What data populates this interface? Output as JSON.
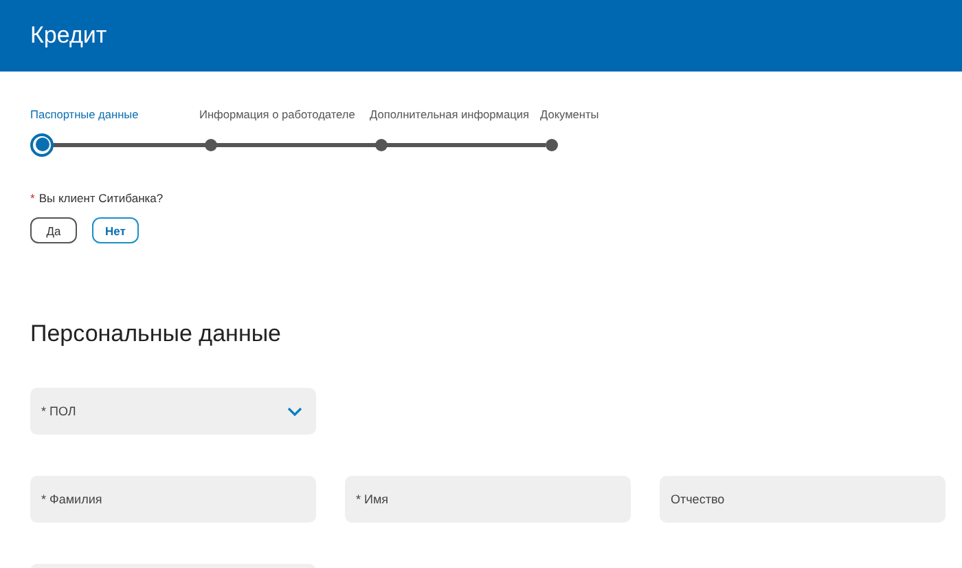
{
  "header": {
    "title": "Кредит"
  },
  "steps": [
    {
      "label": "Паспортные данные",
      "selected": true
    },
    {
      "label": "Информация о работодателе",
      "selected": false
    },
    {
      "label": "Дополнительная информация",
      "selected": false
    },
    {
      "label": "Документы",
      "selected": false
    }
  ],
  "question": {
    "mark": "*",
    "text": "Вы клиент Ситибанка?"
  },
  "answers": [
    {
      "label": "Да",
      "selected": false
    },
    {
      "label": "Нет",
      "selected": true
    }
  ],
  "section_title": "Персональные данные",
  "gender_select": {
    "placeholder": "* ПОЛ"
  },
  "name_fields": [
    {
      "placeholder": "* Фамилия"
    },
    {
      "placeholder": "* Имя"
    },
    {
      "placeholder": "Отчество"
    }
  ]
}
